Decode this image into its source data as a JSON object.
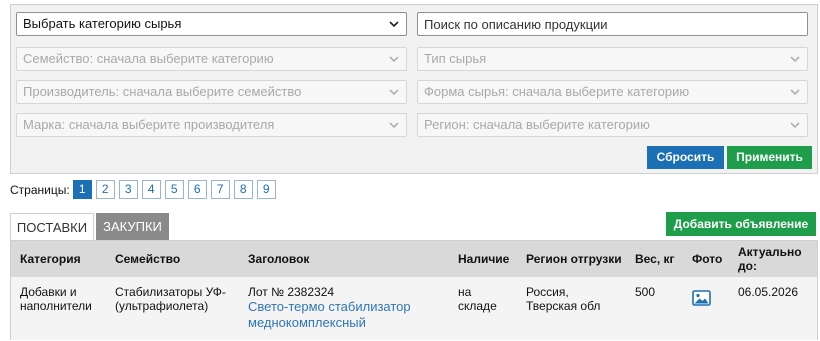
{
  "filters": {
    "category": "Выбрать категорию сырья",
    "search_placeholder": "Поиск по описанию продукции",
    "family": "Семейство: сначала выберите категорию",
    "raw_type": "Тип сырья",
    "manufacturer": "Производитель: сначала выберите семейство",
    "raw_form": "Форма сырья: сначала выберите категорию",
    "brand": "Марка: сначала выберите производителя",
    "region": "Регион: сначала выберите категорию",
    "reset_label": "Сбросить",
    "apply_label": "Применить"
  },
  "pager": {
    "label": "Страницы:",
    "pages": [
      "1",
      "2",
      "3",
      "4",
      "5",
      "6",
      "7",
      "8",
      "9"
    ],
    "current": "1"
  },
  "tabs": {
    "supplies": "ПОСТАВКИ",
    "purchases": "ЗАКУПКИ",
    "add_label": "Добавить объявление"
  },
  "table": {
    "headers": {
      "category": "Категория",
      "family": "Семейство",
      "title": "Заголовок",
      "availability": "Наличие",
      "region": "Регион отгрузки",
      "weight": "Вес, кг",
      "photo": "Фото",
      "actual": "Актуально до:"
    },
    "rows": [
      {
        "category": "Добавки и наполнители",
        "family": "Стабилизаторы УФ-(ультрафиолета)",
        "lot": "Лот № 2382324",
        "title": "Свето-термо стабилизатор меднокомплексный",
        "availability": "на складе",
        "region": "Россия, Тверская обл",
        "weight": "500",
        "photo_icon": "image-icon",
        "actual": "06.05.2026"
      }
    ]
  },
  "colors": {
    "accent_blue": "#1b6fb4",
    "accent_green": "#1e9e4a",
    "link": "#2f76b7",
    "tab_inactive": "#8a8a8a",
    "header_bg": "#d9d9d9"
  }
}
